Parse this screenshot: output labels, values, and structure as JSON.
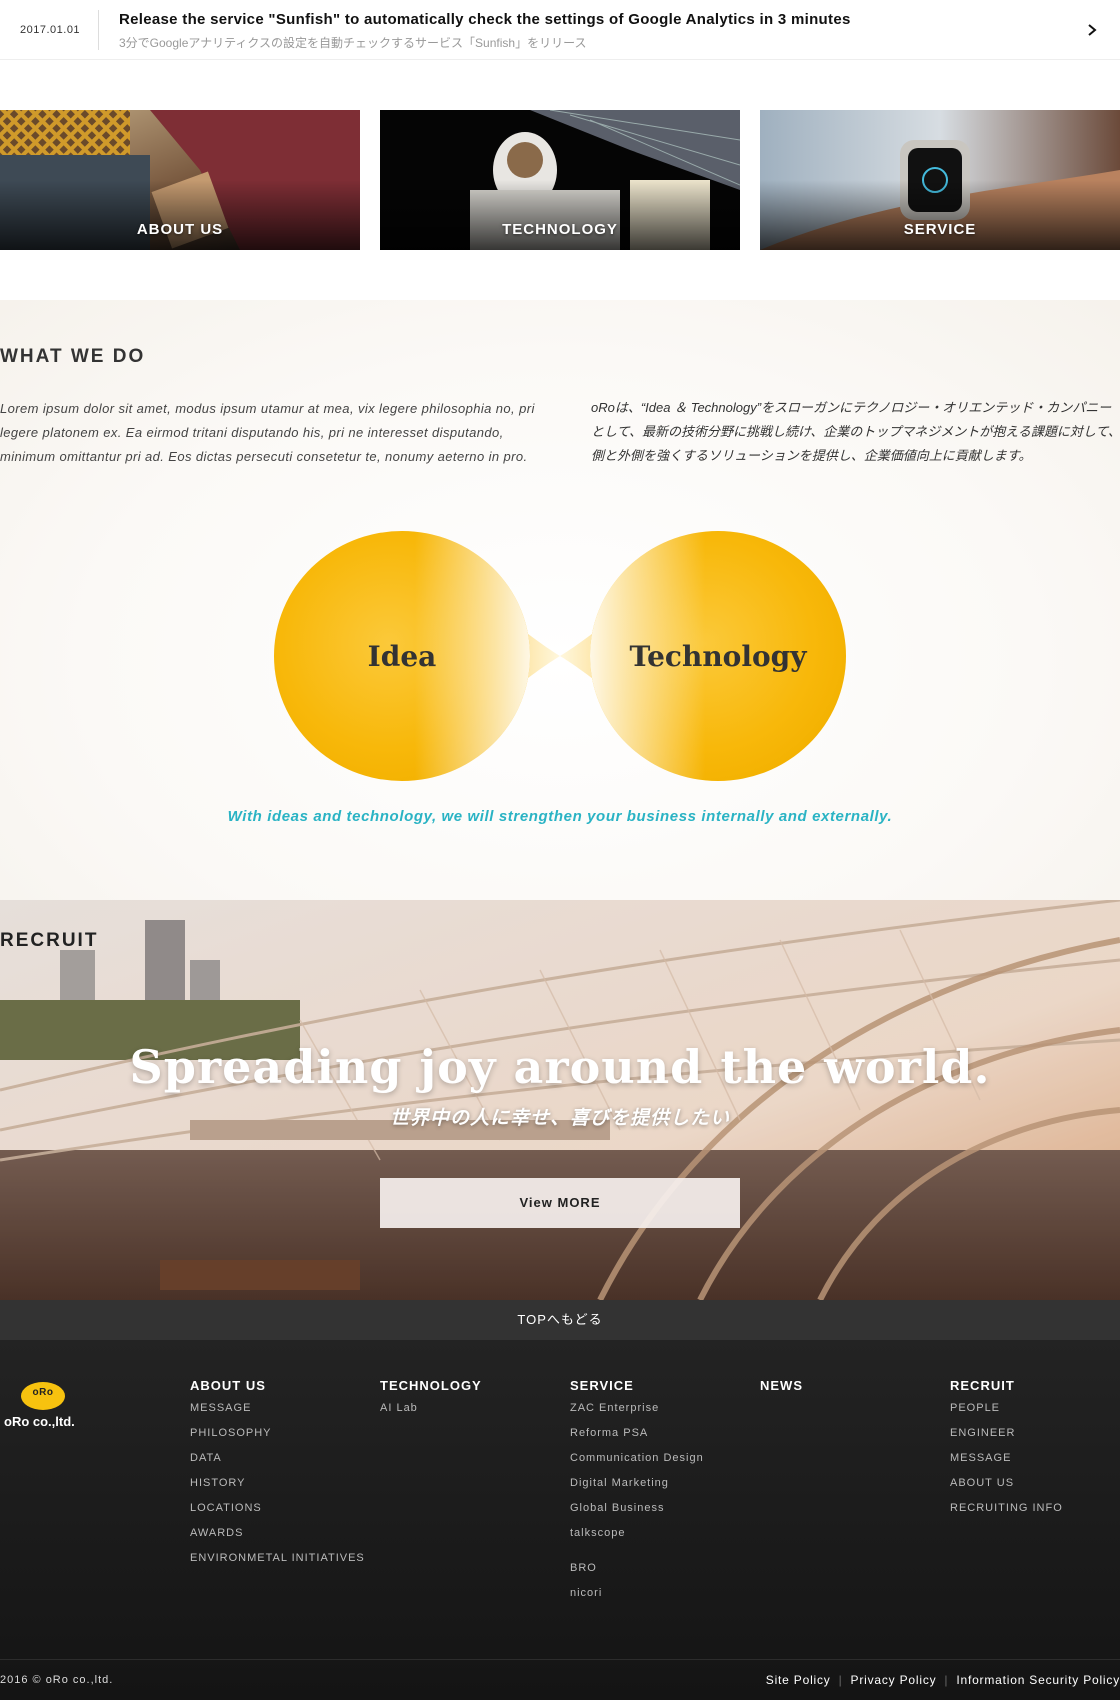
{
  "news": {
    "date": "2017.01.01",
    "title": "Release the service \"Sunfish\" to automatically check the settings of Google Analytics in 3 minutes",
    "subtitle": "3分でGoogleアナリティクスの設定を自動チェックするサービス「Sunfish」をリリース",
    "icon": "chevron-right-icon"
  },
  "cards": [
    {
      "label": "ABOUT US"
    },
    {
      "label": "TECHNOLOGY"
    },
    {
      "label": "SERVICE"
    }
  ],
  "what_we_do": {
    "heading": "WHAT WE DO",
    "text_en": "Lorem ipsum dolor sit amet, modus ipsum utamur at mea, vix legere philosophia no, pri legere platonem ex. Ea eirmod tritani disputando his, pri ne interesset disputando, minimum omittantur pri ad. Eos dictas persecuti consetetur te, nonumy aeterno in pro.",
    "text_jp_lines": [
      "oRoは、“Idea ＆ Technology”をスローガンにテクノロジー・オリエンテッド・カンパニー",
      "として、最新の技術分野に挑戦し続け、企業のトップマネジメントが抱える課題に対して、内",
      "側と外側を強くするソリューションを提供し、企業価値向上に貢献します。"
    ],
    "idea_label": "Idea",
    "tech_label": "Technology",
    "tagline": "With ideas and technology, we will strengthen your business internally and externally.",
    "accent_color": "#2ab3c4",
    "circle_color": "#f7b500"
  },
  "recruit": {
    "heading": "RECRUIT",
    "headline": "Spreading joy around the world.",
    "subline": "世界中の人に幸せ、喜びを提供したい",
    "button": "View MORE"
  },
  "to_top": "TOPへもどる",
  "footer": {
    "logo_mark": "oRo",
    "company": "oRo co.,ltd.",
    "columns": [
      {
        "head": "ABOUT US",
        "items": [
          "MESSAGE",
          "PHILOSOPHY",
          "DATA",
          "HISTORY",
          "LOCATIONS",
          "AWARDS",
          "ENVIRONMETAL INITIATIVES"
        ]
      },
      {
        "head": "TECHNOLOGY",
        "items": [
          "AI Lab"
        ]
      },
      {
        "head": "SERVICE",
        "items": [
          "ZAC Enterprise",
          "Reforma PSA",
          "Communication Design",
          "Digital Marketing",
          "Global Business",
          "talkscope"
        ],
        "items2": [
          "BRO",
          "nicori"
        ]
      },
      {
        "head": "NEWS",
        "items": []
      },
      {
        "head": "RECRUIT",
        "items": [
          "PEOPLE",
          "ENGINEER",
          "MESSAGE",
          "ABOUT US",
          "RECRUITING INFO"
        ]
      }
    ],
    "copyright": "2016 © oRo co.,ltd.",
    "policies": [
      "Site Policy",
      "Privacy Policy",
      "Information Security Policy"
    ]
  }
}
